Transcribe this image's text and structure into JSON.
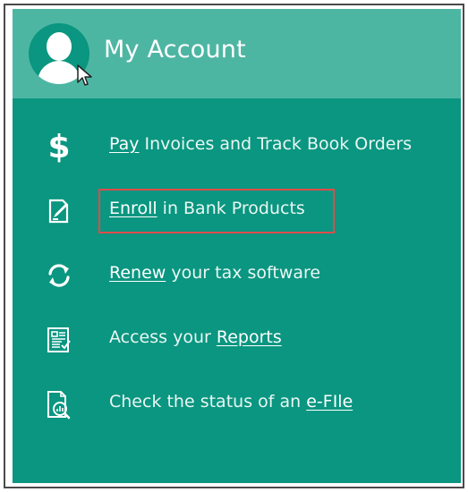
{
  "header": {
    "title": "My Account"
  },
  "menu": [
    {
      "icon": "dollar-icon",
      "link": "Pay",
      "rest": " Invoices and Track Book Orders"
    },
    {
      "icon": "document-edit-icon",
      "link": "Enroll",
      "rest": " in Bank Products"
    },
    {
      "icon": "refresh-icon",
      "link": "Renew",
      "rest": " your tax software"
    },
    {
      "icon": "report-icon",
      "prefix": "Access your ",
      "link": "Reports"
    },
    {
      "icon": "efile-search-icon",
      "prefix": "Check the status of an ",
      "link": "e-FIle"
    }
  ],
  "colors": {
    "panel": "#0a9680",
    "header": "#4db6a3",
    "highlight": "#e04b4b"
  }
}
